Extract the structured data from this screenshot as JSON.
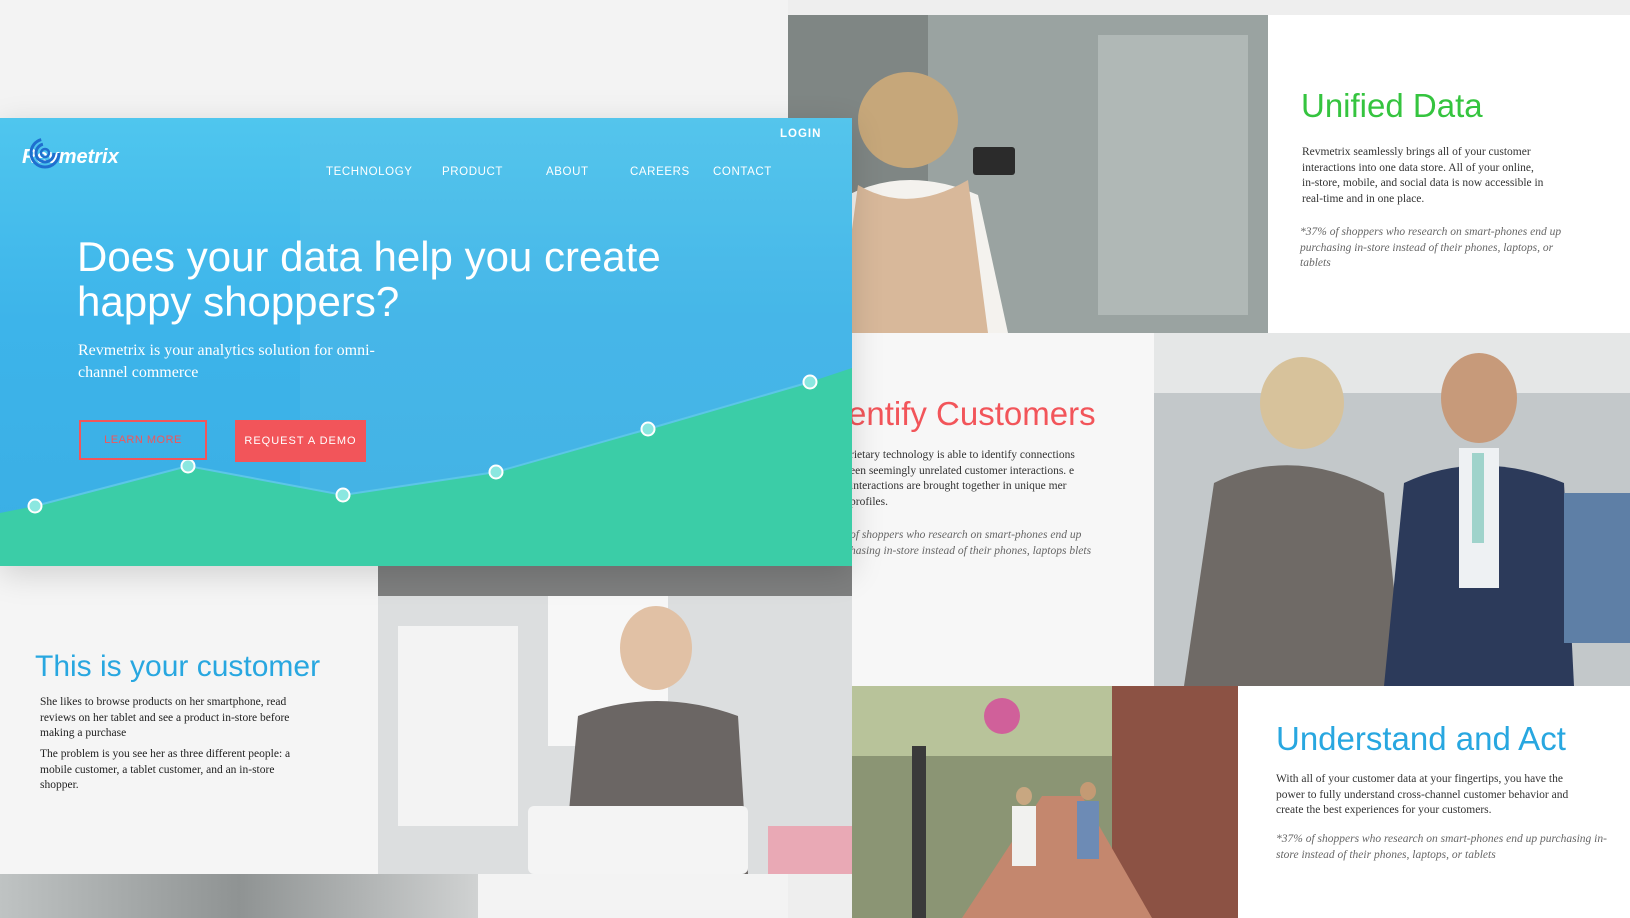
{
  "hero": {
    "login": "LOGIN",
    "brand": "Revmetrix",
    "nav": [
      "TECHNOLOGY",
      "PRODUCT",
      "ABOUT",
      "CAREERS",
      "CONTACT"
    ],
    "title": "Does your data help you create happy shoppers?",
    "subtitle": "Revmetrix is your analytics solution for omni-channel commerce",
    "learn_more": "LEARN MORE",
    "request_demo": "REQUEST A DEMO",
    "colors": {
      "primary": "#3db4ea",
      "accent": "#f2555a",
      "wave": "#3bcfa3"
    }
  },
  "unified": {
    "title": "Unified Data",
    "body": "Revmetrix seamlessly brings all of your customer interactions into one data store. All of your online, in-store, mobile, and social data is now accessible in real-time and in one place.",
    "note": "*37% of shoppers who research on smart-phones end up purchasing in-store instead of their phones, laptops, or tablets"
  },
  "identify": {
    "title": "entify Customers",
    "body": "rietary technology is able to identify connections een seemingly unrelated customer interactions. e interactions are brought together in unique mer profiles.",
    "note": "of shoppers who research on smart-phones end up hasing in-store instead of their phones, laptops blets"
  },
  "customer": {
    "title": "This is your customer",
    "p1": "She likes to browse products on her smartphone, read reviews on her tablet and see a product in-store before making a purchase",
    "p2": "The problem is you see her as three different people: a mobile customer, a tablet customer, and an in-store shopper."
  },
  "understand": {
    "title": "Understand and Act",
    "body": "With all of your customer data at your fingertips, you have the power to fully understand cross-channel customer behavior and create the best experiences for your customers.",
    "note": "*37% of shoppers who research on smart-phones end up purchasing in-store instead of their phones, laptops, or tablets"
  }
}
